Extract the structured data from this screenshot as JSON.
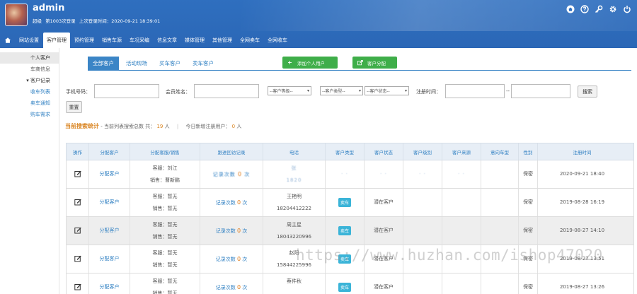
{
  "header": {
    "admin_name": "admin",
    "role_label": "超级",
    "login_count": "第1003次登录",
    "last_login": "上次登录时间：2020-09-21 18:39:01",
    "icons": [
      "home-circle-icon",
      "help-icon",
      "key-icon",
      "gear-icon",
      "power-icon"
    ],
    "colors": {
      "bar": "#2f6fbf",
      "active_tab": "#3b85c6"
    }
  },
  "nav": {
    "items": [
      {
        "label": "网站设置"
      },
      {
        "label": "客户管理",
        "active": true
      },
      {
        "label": "预约管理"
      },
      {
        "label": "销售车源"
      },
      {
        "label": "车况采编"
      },
      {
        "label": "信息文章"
      },
      {
        "label": "媒体管理"
      },
      {
        "label": "其他管理"
      },
      {
        "label": "全网卖车"
      },
      {
        "label": "全网收车"
      }
    ]
  },
  "sidebar": {
    "items": [
      {
        "label": "个人客户",
        "kind": "active"
      },
      {
        "label": "车商信息",
        "kind": "plain"
      },
      {
        "label": "客户记录",
        "kind": "group"
      },
      {
        "label": "收车列表",
        "kind": "sub"
      },
      {
        "label": "卖车通知",
        "kind": "sub"
      },
      {
        "label": "购车需求",
        "kind": "sub"
      }
    ]
  },
  "tabs": [
    {
      "label": "全部客户",
      "active": true
    },
    {
      "label": "活动现场"
    },
    {
      "label": "买车客户"
    },
    {
      "label": "卖车客户"
    }
  ],
  "actions": {
    "add_user": "添加个人用户",
    "assign_customer": "客户分配"
  },
  "filters": {
    "phone_label": "手机号码：",
    "member_label": "会员姓名：",
    "level_select": "--客户等级--",
    "type_select": "--客户类型--",
    "status_select": "--客户状态--",
    "reg_time_label": "注册时间：",
    "range_sep": "--",
    "search_button": "搜索",
    "reset_button": "重置"
  },
  "stats": {
    "title": "当前搜索统计",
    "prefix": "- 当前列表搜索总数 共：",
    "total": "19",
    "unit": "人",
    "today_label": "今日新增注册用户：",
    "today": "0",
    "today_unit": "人"
  },
  "table": {
    "headers": [
      "操作",
      "分配客户",
      "分配客服/销售",
      "跟进回访记录",
      "电话",
      "客户类型",
      "客户状态",
      "客户级别",
      "客户来源",
      "意向车型",
      "性别",
      "注册时间"
    ],
    "rows": [
      {
        "assign": "分配客户",
        "service": "客服：刘江",
        "sales": "销售：曹新鹏",
        "record": "记录次数",
        "record_count": "0",
        "record_unit": "次",
        "name": "张",
        "phone": "1820",
        "type": "",
        "status": "",
        "gender": "保密",
        "time": "2020-09-21 18:40",
        "blurred": true
      },
      {
        "assign": "分配客户",
        "service": "客服：暂无",
        "sales": "销售：暂无",
        "record": "记录次数",
        "record_count": "0",
        "record_unit": "次",
        "name": "王艳明",
        "phone": "18204412222",
        "type": "卖车",
        "status": "潜在客户",
        "gender": "保密",
        "time": "2019-08-28 16:19"
      },
      {
        "assign": "分配客户",
        "service": "客服：暂无",
        "sales": "销售：暂无",
        "record": "记录次数",
        "record_count": "0",
        "record_unit": "次",
        "name": "周主星",
        "phone": "18043220996",
        "type": "卖车",
        "status": "潜在客户",
        "gender": "保密",
        "time": "2019-08-27 14:10"
      },
      {
        "assign": "分配客户",
        "service": "客服：暂无",
        "sales": "销售：暂无",
        "record": "记录次数",
        "record_count": "0",
        "record_unit": "次",
        "name": "赵阳",
        "phone": "15844225996",
        "type": "卖车",
        "status": "潜在客户",
        "gender": "保密",
        "time": "2019-08-27 13:51"
      },
      {
        "assign": "分配客户",
        "service": "客服：暂无",
        "sales": "销售：暂无",
        "record": "记录次数",
        "record_count": "0",
        "record_unit": "次",
        "name": "蔡件秋",
        "phone": "",
        "type": "卖车",
        "status": "潜在客户",
        "gender": "保密",
        "time": "2019-08-27 13:26"
      }
    ]
  },
  "watermark": "https://www.huzhan.com/ishop47020"
}
